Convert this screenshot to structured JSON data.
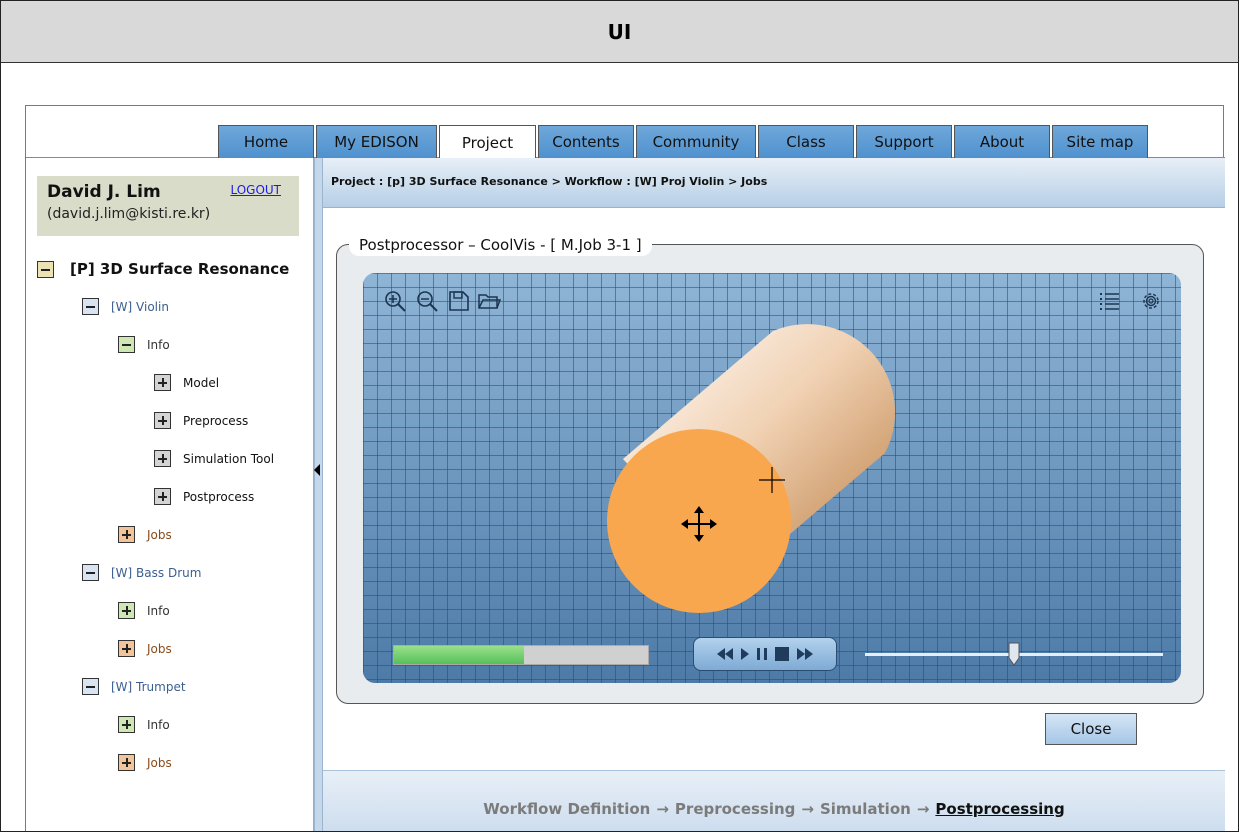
{
  "title": "UI",
  "tabs": [
    {
      "label": "Home",
      "active": false
    },
    {
      "label": "My EDISON",
      "active": false
    },
    {
      "label": "Project",
      "active": true
    },
    {
      "label": "Contents",
      "active": false
    },
    {
      "label": "Community",
      "active": false
    },
    {
      "label": "Class",
      "active": false
    },
    {
      "label": "Support",
      "active": false
    },
    {
      "label": "About",
      "active": false
    },
    {
      "label": "Site map",
      "active": false
    }
  ],
  "user": {
    "name": "David J. Lim",
    "email": "(david.j.lim@kisti.re.kr)",
    "logout": "LOGOUT"
  },
  "tree": [
    {
      "label": "[P] 3D Surface Resonance",
      "icon": "collapse",
      "color": "beige"
    },
    {
      "label": "[W] Violin",
      "icon": "collapse",
      "color": "blue"
    },
    {
      "label": "Info",
      "icon": "collapse",
      "color": "green"
    },
    {
      "label": "Model",
      "icon": "expand",
      "color": "grey"
    },
    {
      "label": "Preprocess",
      "icon": "expand",
      "color": "grey"
    },
    {
      "label": "Simulation Tool",
      "icon": "expand",
      "color": "grey"
    },
    {
      "label": "Postprocess",
      "icon": "expand",
      "color": "grey"
    },
    {
      "label": "Jobs",
      "icon": "expand",
      "color": "orange"
    },
    {
      "label": "[W] Bass Drum",
      "icon": "collapse",
      "color": "blue"
    },
    {
      "label": "Info",
      "icon": "expand",
      "color": "green"
    },
    {
      "label": "Jobs",
      "icon": "expand",
      "color": "orange"
    },
    {
      "label": "[W] Trumpet",
      "icon": "collapse",
      "color": "blue"
    },
    {
      "label": "Info",
      "icon": "expand",
      "color": "green"
    },
    {
      "label": "Jobs",
      "icon": "expand",
      "color": "orange"
    }
  ],
  "breadcrumb": "Project : [p] 3D Surface Resonance > Workflow : [W] Proj Violin > Jobs",
  "panel": {
    "title": "Postprocessor – CoolVis - [ M.Job 3-1 ]",
    "progress": 0.51,
    "slider_position": 0.5,
    "toolbar_icons": [
      "zoom-in-icon",
      "zoom-out-icon",
      "save-icon",
      "open-folder-icon"
    ],
    "right_icons": [
      "list-icon",
      "gear-icon"
    ],
    "playback_icons": [
      "rewind-icon",
      "play-icon",
      "pause-icon",
      "stop-icon",
      "fast-forward-icon"
    ]
  },
  "close_label": "Close",
  "steps": {
    "items": [
      "Workflow Definition",
      "Preprocessing",
      "Simulation",
      "Postprocessing"
    ],
    "arrow": "→",
    "current": "Postprocessing"
  },
  "colors": {
    "tab": "#5b9bd5",
    "cylinder_face": "#f9a74f",
    "progress": "#56c05a",
    "username_box": "#d9dcc9"
  }
}
